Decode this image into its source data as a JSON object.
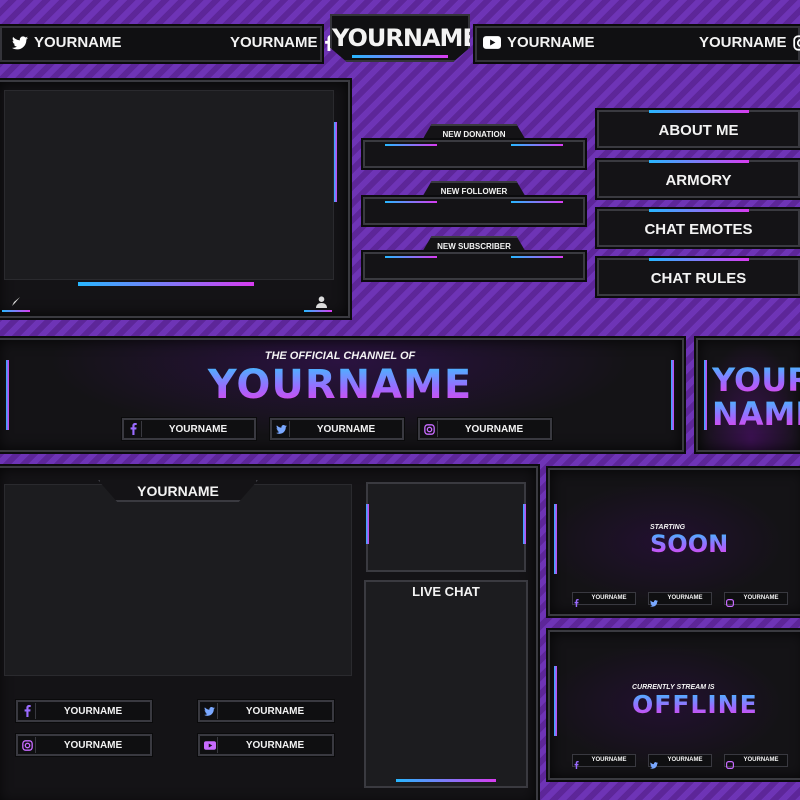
{
  "colors": {
    "accent_blue": "#27b7ff",
    "accent_pink": "#d83cf0",
    "panel": "#141316",
    "background": "#6a2fb0"
  },
  "top_bar": {
    "twitter_name": "YOURNAME",
    "facebook_name": "YOURNAME",
    "title": "YOURNAME",
    "youtube_name": "YOURNAME",
    "instagram_name": "YOURNAME"
  },
  "alerts": [
    {
      "label": "NEW DONATION"
    },
    {
      "label": "NEW FOLLOWER"
    },
    {
      "label": "NEW SUBSCRIBER"
    }
  ],
  "panels": [
    {
      "label": "ABOUT ME"
    },
    {
      "label": "ARMORY"
    },
    {
      "label": "CHAT EMOTES"
    },
    {
      "label": "CHAT RULES"
    }
  ],
  "banner": {
    "subtitle": "THE OFFICIAL CHANNEL OF",
    "title": "YOURNAME",
    "socials": [
      {
        "icon": "facebook-icon",
        "name": "YOURNAME"
      },
      {
        "icon": "twitter-icon",
        "name": "YOURNAME"
      },
      {
        "icon": "instagram-icon",
        "name": "YOURNAME"
      }
    ]
  },
  "profile_pic": {
    "line1": "YOUR",
    "line2": "NAME"
  },
  "overlay": {
    "title": "YOURNAME",
    "live_chat": "LIVE CHAT",
    "socials": [
      {
        "icon": "facebook-icon",
        "name": "YOURNAME"
      },
      {
        "icon": "twitter-icon",
        "name": "YOURNAME"
      },
      {
        "icon": "instagram-icon",
        "name": "YOURNAME"
      },
      {
        "icon": "youtube-icon",
        "name": "YOURNAME"
      }
    ]
  },
  "starting_screen": {
    "small": "STARTING",
    "big": "SOON",
    "socials": [
      "YOURNAME",
      "YOURNAME",
      "YOURNAME"
    ]
  },
  "offline_screen": {
    "small": "CURRENTLY STREAM IS",
    "big": "OFFLINE",
    "socials": [
      "YOURNAME",
      "YOURNAME",
      "YOURNAME"
    ]
  }
}
